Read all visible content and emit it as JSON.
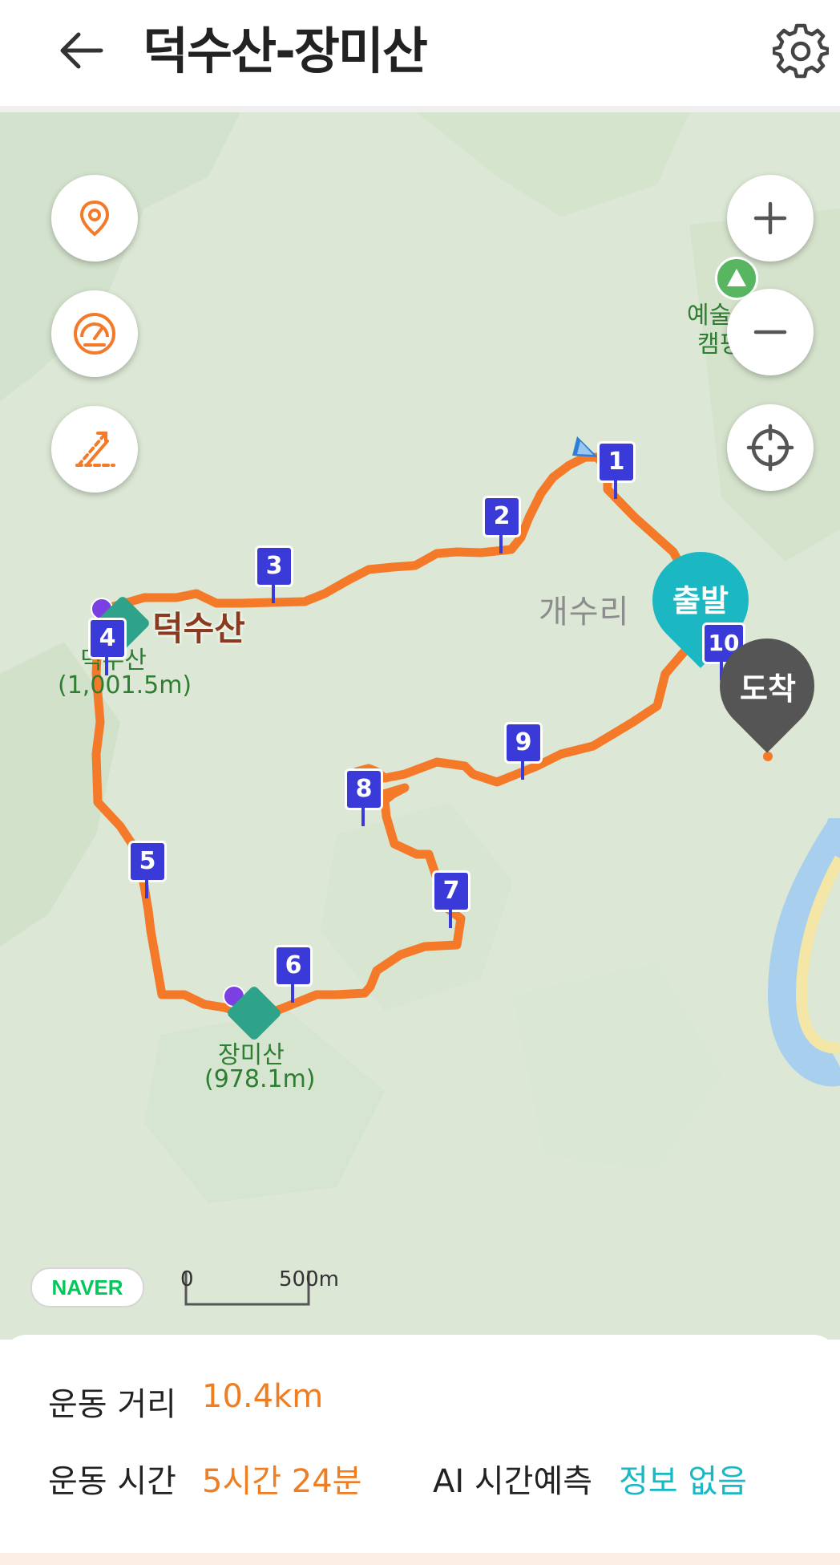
{
  "header": {
    "title": "덕수산-장미산"
  },
  "map": {
    "village_label": "개수리",
    "peaks": [
      {
        "name": "덕수산",
        "sub_name": "덕수산",
        "elevation": "(1,001.5m)"
      },
      {
        "name": "장미산",
        "elevation": "(978.1m)"
      }
    ],
    "camp_label_1": "예술",
    "camp_label_2": "캠핑",
    "waypoints": [
      "1",
      "2",
      "3",
      "4",
      "5",
      "6",
      "7",
      "8",
      "9",
      "10"
    ],
    "start_label": "출발",
    "end_label": "도착",
    "scale": {
      "start": "0",
      "end": "500m"
    },
    "provider": "NAVER",
    "colors": {
      "route": "#f47a2a",
      "start": "#1bb8c4",
      "end": "#555555",
      "waypoint": "#3a3ad8"
    }
  },
  "controls": {
    "left": [
      "location-pin-icon",
      "speedometer-icon",
      "slope-icon"
    ],
    "right": [
      "zoom-in-icon",
      "zoom-out-icon",
      "crosshair-icon"
    ]
  },
  "stats": {
    "distance_label": "운동 거리",
    "distance_value": "10.4km",
    "time_label": "운동 시간",
    "time_value": "5시간 24분",
    "ai_label": "AI 시간예측",
    "ai_value": "정보 없음"
  }
}
